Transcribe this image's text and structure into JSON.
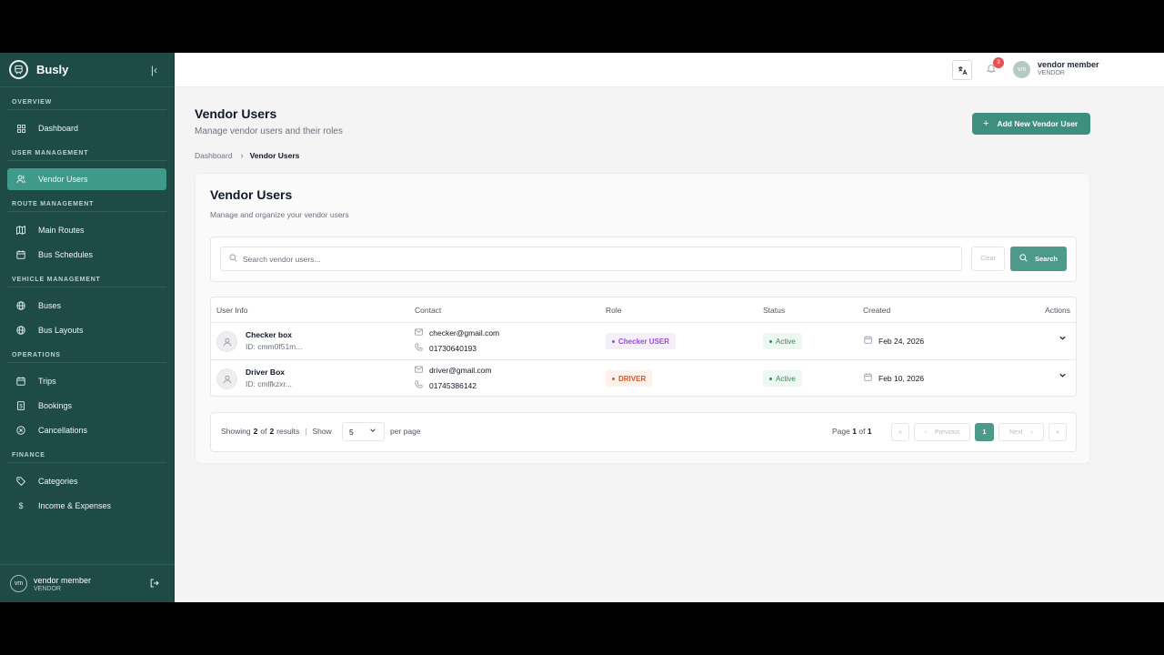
{
  "sidebar": {
    "brand": "Busly",
    "sections": [
      {
        "label": "OVERVIEW",
        "items": [
          {
            "label": "Dashboard",
            "icon": "grid-icon"
          }
        ]
      },
      {
        "label": "USER MANAGEMENT",
        "items": [
          {
            "label": "Vendor Users",
            "icon": "users-icon",
            "active": true
          }
        ]
      },
      {
        "label": "ROUTE MANAGEMENT",
        "items": [
          {
            "label": "Main Routes",
            "icon": "map-icon"
          },
          {
            "label": "Bus Schedules",
            "icon": "calendar-icon"
          }
        ]
      },
      {
        "label": "VEHICLE MANAGEMENT",
        "items": [
          {
            "label": "Buses",
            "icon": "globe-icon"
          },
          {
            "label": "Bus Layouts",
            "icon": "globe-icon"
          }
        ]
      },
      {
        "label": "OPERATIONS",
        "items": [
          {
            "label": "Trips",
            "icon": "calendar-icon"
          },
          {
            "label": "Bookings",
            "icon": "receipt-icon"
          },
          {
            "label": "Cancellations",
            "icon": "cancel-icon"
          }
        ]
      },
      {
        "label": "FINANCE",
        "items": [
          {
            "label": "Categories",
            "icon": "tag-icon"
          },
          {
            "label": "Income & Expenses",
            "icon": "dollar-icon"
          }
        ]
      }
    ],
    "footer": {
      "initials": "vm",
      "name": "vendor member",
      "role": "VENDOR"
    }
  },
  "topbar": {
    "notification_count": "3",
    "user_initials": "vm",
    "user_name": "vendor member",
    "user_role": "VENDOR"
  },
  "page": {
    "title": "Vendor Users",
    "subtitle": "Manage vendor users and their roles",
    "add_button": "Add New Vendor User",
    "breadcrumb": {
      "parent": "Dashboard",
      "current": "Vendor Users"
    }
  },
  "card": {
    "title": "Vendor Users",
    "subtitle": "Manage and organize your vendor users",
    "search": {
      "placeholder": "Search vendor users...",
      "clear_label": "Clear",
      "search_label": "Search"
    }
  },
  "table": {
    "headers": [
      "User Info",
      "Contact",
      "Role",
      "Status",
      "Created",
      "Actions"
    ],
    "rows": [
      {
        "name": "Checker box",
        "id": "ID: cmm0f51m...",
        "email": "checker@gmail.com",
        "phone": "01730640193",
        "role": "Checker USER",
        "status": "Active",
        "created": "Feb 24, 2026"
      },
      {
        "name": "Driver Box",
        "id": "ID: cmlfkzxr...",
        "email": "driver@gmail.com",
        "phone": "01745386142",
        "role": "DRIVER",
        "status": "Active",
        "created": "Feb 10, 2026"
      }
    ]
  },
  "pagination": {
    "showing_prefix": "Showing",
    "shown_count": "2",
    "of": "of",
    "total_count": "2",
    "results": "results",
    "show_label": "Show",
    "per_page_value": "5",
    "per_page_label": "per page",
    "page_prefix": "Page",
    "current_page": "1",
    "page_of": "of",
    "total_pages": "1",
    "first_label": "«",
    "prev_label": "Previous",
    "next_label": "Next",
    "last_label": "»"
  },
  "colors": {
    "sidebar_bg": "#1e4b45",
    "accent": "#3f9a8a",
    "primary_button": "#3f8f7f",
    "badge_red": "#e25353",
    "role_checker": "#9b4fd4",
    "role_driver": "#d15a2a",
    "status_active": "#2f8a5a"
  }
}
